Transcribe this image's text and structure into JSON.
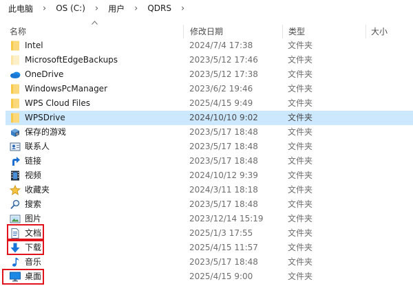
{
  "breadcrumb": [
    "此电脑",
    "OS (C:)",
    "用户",
    "QDRS"
  ],
  "columns": {
    "name": "名称",
    "date": "修改日期",
    "type": "类型",
    "size": "大小"
  },
  "rows": [
    {
      "name": "Intel",
      "date": "2024/7/4 17:38",
      "type": "文件夹",
      "icon": "folder-icon"
    },
    {
      "name": "MicrosoftEdgeBackups",
      "date": "2023/5/12 17:46",
      "type": "文件夹",
      "icon": "folder-light-icon"
    },
    {
      "name": "OneDrive",
      "date": "2023/5/12 17:38",
      "type": "文件夹",
      "icon": "onedrive-cloud-icon"
    },
    {
      "name": "WindowsPcManager",
      "date": "2023/6/2 19:46",
      "type": "文件夹",
      "icon": "folder-icon"
    },
    {
      "name": "WPS Cloud Files",
      "date": "2025/4/15 9:49",
      "type": "文件夹",
      "icon": "folder-icon"
    },
    {
      "name": "WPSDrive",
      "date": "2024/10/10 9:02",
      "type": "文件夹",
      "icon": "folder-icon",
      "selected": true
    },
    {
      "name": "保存的游戏",
      "date": "2023/5/17 18:48",
      "type": "文件夹",
      "icon": "saved-games-icon"
    },
    {
      "name": "联系人",
      "date": "2023/5/17 18:48",
      "type": "文件夹",
      "icon": "contacts-icon"
    },
    {
      "name": "链接",
      "date": "2023/5/17 18:48",
      "type": "文件夹",
      "icon": "links-arrow-icon"
    },
    {
      "name": "视频",
      "date": "2024/10/12 9:39",
      "type": "文件夹",
      "icon": "videos-film-icon"
    },
    {
      "name": "收藏夹",
      "date": "2024/3/11 18:18",
      "type": "文件夹",
      "icon": "favorites-star-icon"
    },
    {
      "name": "搜索",
      "date": "2023/5/17 18:48",
      "type": "文件夹",
      "icon": "search-magnifier-icon"
    },
    {
      "name": "图片",
      "date": "2023/12/14 15:19",
      "type": "文件夹",
      "icon": "pictures-icon"
    },
    {
      "name": "文档",
      "date": "2025/1/3 17:55",
      "type": "文件夹",
      "icon": "documents-icon",
      "highlight": true
    },
    {
      "name": "下载",
      "date": "2025/4/15 11:57",
      "type": "文件夹",
      "icon": "downloads-arrow-icon",
      "highlight": true
    },
    {
      "name": "音乐",
      "date": "2023/5/17 18:48",
      "type": "文件夹",
      "icon": "music-note-icon"
    },
    {
      "name": "桌面",
      "date": "2025/4/15 9:00",
      "type": "文件夹",
      "icon": "desktop-monitor-icon",
      "highlight": true
    }
  ],
  "colors": {
    "selection": "#cce8ff",
    "highlight_box": "#e0121a",
    "folder": "#f7c948"
  }
}
